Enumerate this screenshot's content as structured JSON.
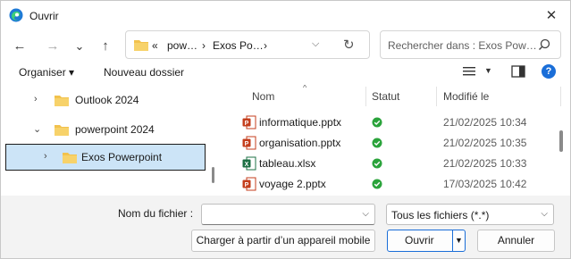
{
  "window": {
    "title": "Ouvrir"
  },
  "nav": {
    "back": "←",
    "forward": "→",
    "recent": "⌄",
    "up": "↑"
  },
  "address": {
    "chevron_left": "«",
    "segments": [
      "pow…",
      "Exos Po…"
    ],
    "separator": "›"
  },
  "search": {
    "placeholder": "Rechercher dans : Exos Pow…"
  },
  "commandbar": {
    "organize": "Organiser ▾",
    "new_folder": "Nouveau dossier"
  },
  "tree": {
    "items": [
      {
        "label": "Outlook 2024",
        "expanded": false,
        "selected": false
      },
      {
        "label": "powerpoint 2024",
        "expanded": true,
        "selected": false
      },
      {
        "label": "Exos Powerpoint",
        "expanded": false,
        "selected": true
      }
    ]
  },
  "columns": {
    "name": "Nom",
    "status": "Statut",
    "modified": "Modifié le",
    "sort_arrow": "^"
  },
  "files": [
    {
      "name": "informatique.pptx",
      "type": "pptx",
      "date": "21/02/2025 10:34"
    },
    {
      "name": "organisation.pptx",
      "type": "pptx",
      "date": "21/02/2025 10:35"
    },
    {
      "name": "tableau.xlsx",
      "type": "xlsx",
      "date": "21/02/2025 10:33"
    },
    {
      "name": "voyage 2.pptx",
      "type": "pptx",
      "date": "17/03/2025 10:42"
    }
  ],
  "bottom": {
    "filename_label": "Nom du fichier :",
    "filename_value": "",
    "filter_value": "Tous les fichiers (*.*)",
    "device_button": "Charger à partir d’un appareil mobile",
    "open_button": "Ouvrir",
    "cancel_button": "Annuler"
  },
  "colors": {
    "accent": "#1a6ed8",
    "selection": "#cce4f7",
    "folder": "#f2c24d",
    "ppt": "#c43e1c",
    "xls": "#1d7044",
    "ok": "#2aa33b"
  }
}
